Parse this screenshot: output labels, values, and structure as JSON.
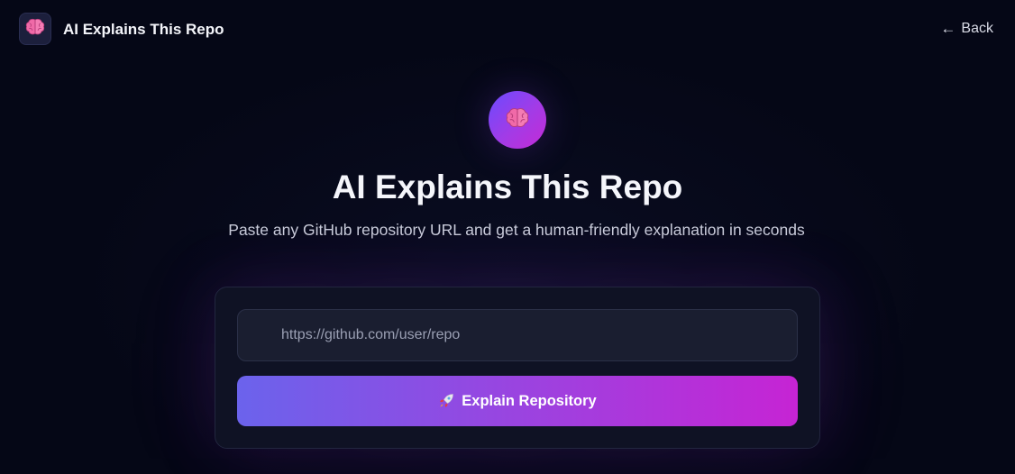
{
  "header": {
    "brand": "AI Explains This Repo",
    "logo_icon": "brain-icon",
    "back_arrow": "←",
    "back_label": "Back"
  },
  "hero": {
    "icon": "brain-icon",
    "title": "AI Explains This Repo",
    "subtitle": "Paste any GitHub repository URL and get a human-friendly explanation in seconds"
  },
  "form": {
    "url_placeholder": "https://github.com/user/repo",
    "url_value": "",
    "submit_icon": "rocket-icon",
    "submit_label": "Explain Repository"
  },
  "colors": {
    "background": "#050716",
    "accent_start": "#6b63ec",
    "accent_end": "#c624d4",
    "brain_pink": "#f06aa8"
  }
}
